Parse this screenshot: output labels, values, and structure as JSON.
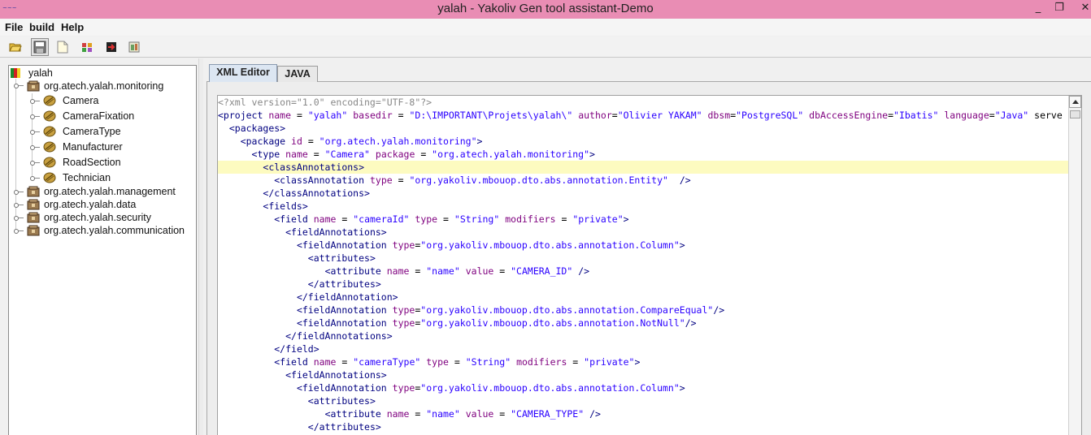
{
  "window": {
    "app_icon_text": "~~~",
    "title": "yalah - Yakoliv Gen tool assistant-Demo",
    "minimize": "_",
    "restore": "❐",
    "close": "✕",
    "title_color": "#e98db4"
  },
  "menu": [
    {
      "label": "File"
    },
    {
      "label": "build"
    },
    {
      "label": "Help"
    }
  ],
  "toolbar": {
    "buttons": [
      {
        "icon": "open-folder-icon"
      },
      {
        "icon": "save-icon",
        "pressed": true
      },
      {
        "icon": "new-file-icon"
      },
      {
        "icon": "generate-icon"
      },
      {
        "icon": "export-icon"
      },
      {
        "icon": "build-icon"
      }
    ]
  },
  "tree": {
    "root": "yalah",
    "packages": [
      {
        "label": "org.atech.yalah.monitoring",
        "expanded": true,
        "classes": [
          "Camera",
          "CameraFixation",
          "CameraType",
          "Manufacturer",
          "RoadSection",
          "Technician"
        ]
      },
      {
        "label": "org.atech.yalah.management"
      },
      {
        "label": "org.atech.yalah.data"
      },
      {
        "label": "org.atech.yalah.security"
      },
      {
        "label": "org.atech.yalah.communication"
      }
    ]
  },
  "editor": {
    "tabs": [
      {
        "label": "XML Editor",
        "active": true
      },
      {
        "label": "JAVA",
        "active": false
      }
    ],
    "highlighted_line": 5,
    "lines": [
      "<?xml version=\"1.0\" encoding=\"UTF-8\"?>",
      "<project name = \"yalah\" basedir = \"D:\\IMPORTANT\\Projets\\yalah\\\" author=\"Olivier YAKAM\" dbsm=\"PostgreSQL\" dbAccessEngine=\"Ibatis\" language=\"Java\" serve",
      "  <packages>",
      "    <package id = \"org.atech.yalah.monitoring\">",
      "      <type name = \"Camera\" package = \"org.atech.yalah.monitoring\">",
      "        <classAnnotations>",
      "          <classAnnotation type = \"org.yakoliv.mbouop.dto.abs.annotation.Entity\"  />",
      "        </classAnnotations>",
      "        <fields>",
      "          <field name = \"cameraId\" type = \"String\" modifiers = \"private\">",
      "            <fieldAnnotations>",
      "              <fieldAnnotation type=\"org.yakoliv.mbouop.dto.abs.annotation.Column\">",
      "                <attributes>",
      "                   <attribute name = \"name\" value = \"CAMERA_ID\" />",
      "                </attributes>",
      "              </fieldAnnotation>",
      "              <fieldAnnotation type=\"org.yakoliv.mbouop.dto.abs.annotation.CompareEqual\"/>",
      "              <fieldAnnotation type=\"org.yakoliv.mbouop.dto.abs.annotation.NotNull\"/>",
      "            </fieldAnnotations>",
      "          </field>",
      "          <field name = \"cameraType\" type = \"String\" modifiers = \"private\">",
      "            <fieldAnnotations>",
      "              <fieldAnnotation type=\"org.yakoliv.mbouop.dto.abs.annotation.Column\">",
      "                <attributes>",
      "                   <attribute name = \"name\" value = \"CAMERA_TYPE\" />",
      "                </attributes>"
    ]
  }
}
